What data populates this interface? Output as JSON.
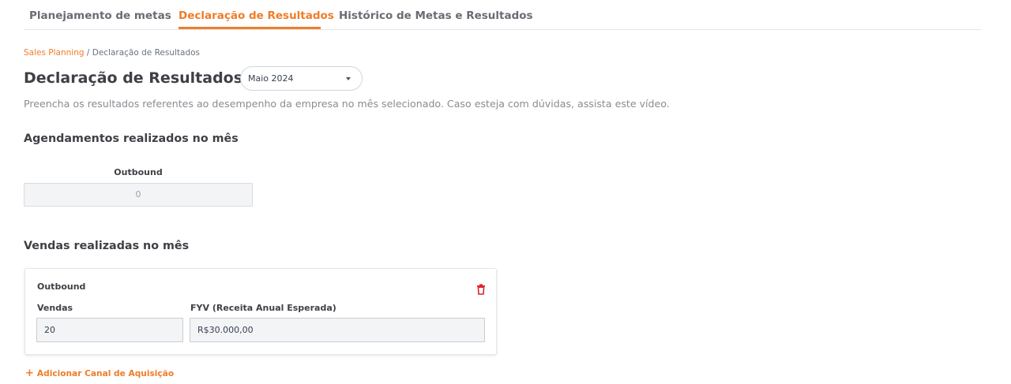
{
  "tabs": {
    "planejamento": "Planejamento de metas",
    "declaracao": "Declaração de Resultados",
    "historico": "Histórico de Metas e Resultados"
  },
  "breadcrumb": {
    "link": "Sales Planning",
    "separator": " / ",
    "current": "Declaração de Resultados"
  },
  "page": {
    "title": "Declaração de Resultados",
    "month_selected": "Maio 2024",
    "subtitle": "Preencha os resultados referentes ao desempenho da empresa no mês selecionado. Caso esteja com dúvidas, assista este vídeo."
  },
  "agendamentos": {
    "title": "Agendamentos realizados no mês",
    "outbound_label": "Outbound",
    "outbound_value": "0"
  },
  "vendas": {
    "title": "Vendas realizadas no mês",
    "card": {
      "channel": "Outbound",
      "vendas_label": "Vendas",
      "vendas_value": "20",
      "fyv_label": "FYV (Receita Anual Esperada)",
      "fyv_value": "R$30.000,00"
    },
    "add_label": "Adicionar Canal de Aquisição",
    "add_icon": "+"
  },
  "colors": {
    "accent": "#f07c28",
    "danger": "#dc2626",
    "text": "#3f3f46"
  }
}
